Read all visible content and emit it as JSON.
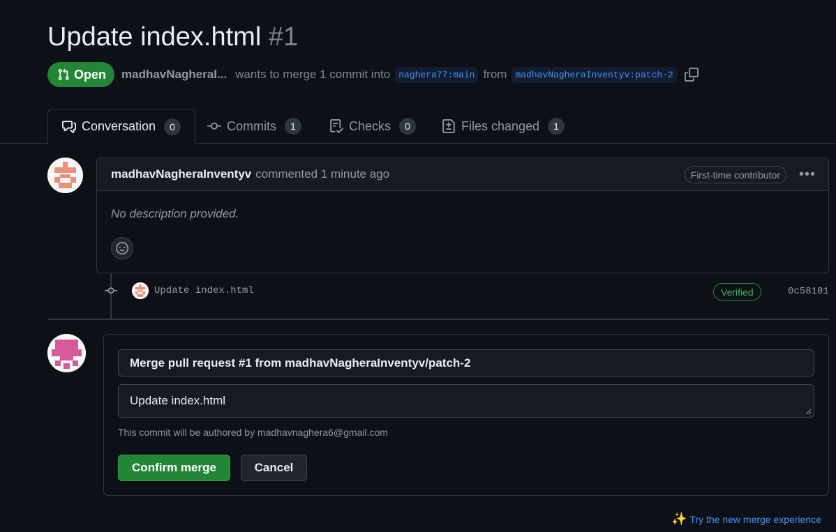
{
  "pr": {
    "title": "Update index.html",
    "number": "#1",
    "state": "Open",
    "author_short": "madhavNagheral...",
    "wants_text": "wants to merge 1 commit into",
    "base_branch": "naghera77:main",
    "from_text": "from",
    "head_branch": "madhavNagheraInventyv:patch-2"
  },
  "tabs": [
    {
      "label": "Conversation",
      "count": "0"
    },
    {
      "label": "Commits",
      "count": "1"
    },
    {
      "label": "Checks",
      "count": "0"
    },
    {
      "label": "Files changed",
      "count": "1"
    }
  ],
  "comment": {
    "author": "madhavNagheraInventyv",
    "action": "commented 1 minute ago",
    "label": "First-time contributor",
    "body": "No description provided."
  },
  "commit": {
    "message": "Update index.html",
    "verified": "Verified",
    "sha": "0c58101"
  },
  "merge": {
    "title_value": "Merge pull request #1 from madhavNagheraInventyv/patch-2",
    "body_value": "Update index.html",
    "author_note": "This commit will be authored by madhavnaghera6@gmail.com",
    "confirm_label": "Confirm merge",
    "cancel_label": "Cancel"
  },
  "footer": {
    "try_link": "Try the new merge experience"
  },
  "colors": {
    "accent_green": "#238636",
    "link_blue": "#4493f8",
    "background": "#0d1117"
  }
}
